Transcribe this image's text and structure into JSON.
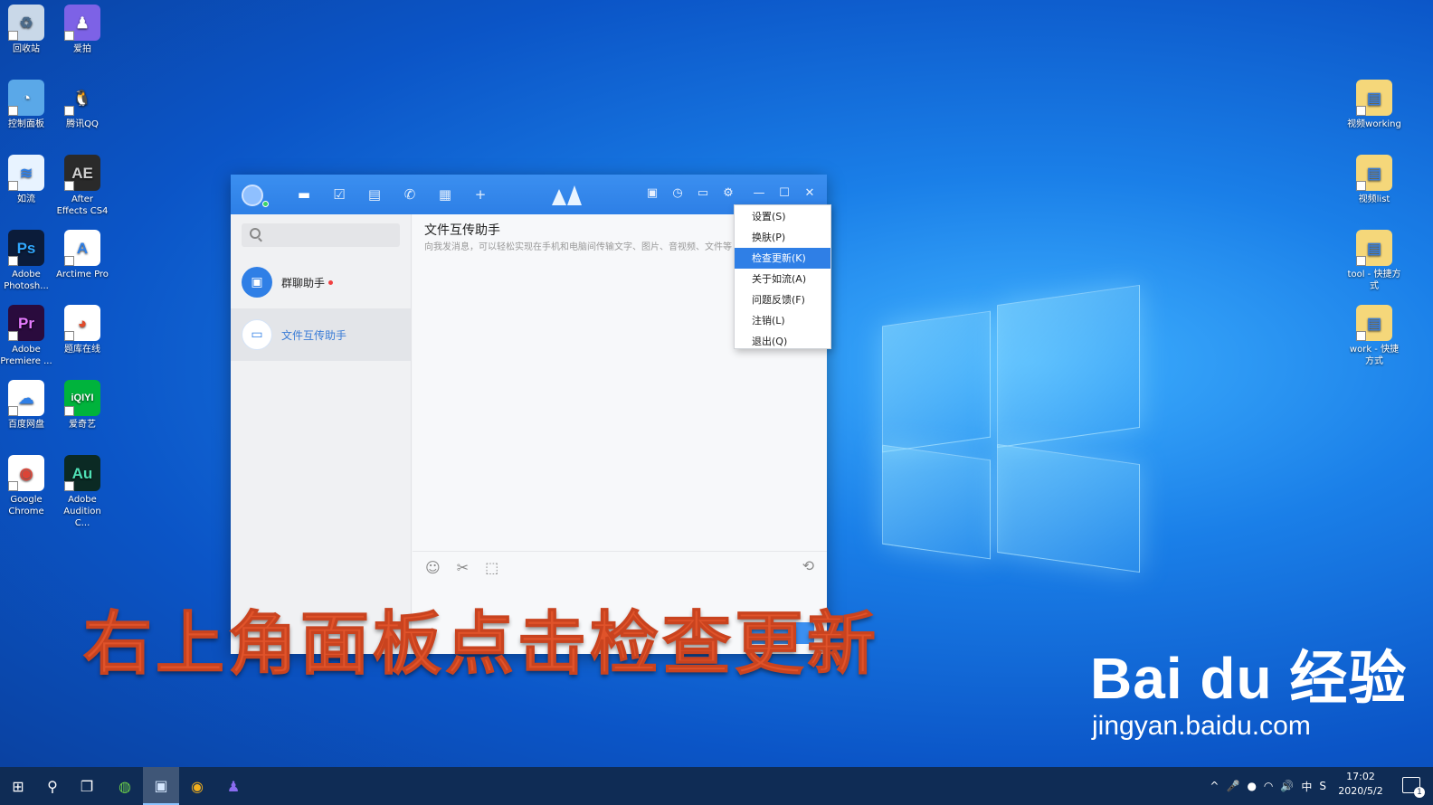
{
  "desktop_icons_left": [
    {
      "label": "回收站",
      "glyph": "♻",
      "bg": "#c9d8e8",
      "fg": "#4a6a8a"
    },
    {
      "label": "爱拍",
      "glyph": "♟",
      "bg": "#7d62e6",
      "fg": "#ffffff"
    },
    {
      "label": "控制面板",
      "glyph": "◔",
      "bg": "#5aa8e8",
      "fg": "#ffffff"
    },
    {
      "label": "腾讯QQ",
      "glyph": "🐧",
      "bg": "transparent",
      "fg": "#111111"
    },
    {
      "label": "如流",
      "glyph": "≋",
      "bg": "#e8f3ff",
      "fg": "#2f7fe6"
    },
    {
      "label": "After Effects CS4",
      "glyph": "AE",
      "bg": "#2a2a2a",
      "fg": "#cfcfcf"
    },
    {
      "label": "Adobe Photosh...",
      "glyph": "Ps",
      "bg": "#0b1c3a",
      "fg": "#31a8ff"
    },
    {
      "label": "Arctime Pro",
      "glyph": "A",
      "bg": "#ffffff",
      "fg": "#2f7fe6"
    },
    {
      "label": "Adobe Premiere ...",
      "glyph": "Pr",
      "bg": "#2a0b3d",
      "fg": "#e77cff"
    },
    {
      "label": "题库在线",
      "glyph": "◕",
      "bg": "#ffffff",
      "fg": "#e04a2a"
    },
    {
      "label": "百度网盘",
      "glyph": "☁",
      "bg": "#ffffff",
      "fg": "#2f7fe6"
    },
    {
      "label": "爱奇艺",
      "glyph": "iQIYI",
      "bg": "#00b33c",
      "fg": "#ffffff"
    },
    {
      "label": "Google Chrome",
      "glyph": "◉",
      "bg": "#ffffff",
      "fg": "#db4437"
    },
    {
      "label": "Adobe Audition C...",
      "glyph": "Au",
      "bg": "#0b2a24",
      "fg": "#4fe0b5"
    }
  ],
  "desktop_icons_right": [
    {
      "label": "视频working",
      "glyph": "▤",
      "bg": "#f5d77a",
      "fg": "#3a7cd6"
    },
    {
      "label": "视频list",
      "glyph": "▤",
      "bg": "#f5d77a",
      "fg": "#3a7cd6"
    },
    {
      "label": "tool - 快捷方式",
      "glyph": "▤",
      "bg": "#f5d77a",
      "fg": "#3a7cd6"
    },
    {
      "label": "work - 快捷方式",
      "glyph": "▤",
      "bg": "#f5d77a",
      "fg": "#3a7cd6"
    }
  ],
  "app": {
    "nav_icons": [
      "chat-icon",
      "calendar-icon",
      "contacts-icon",
      "phone-icon",
      "apps-icon",
      "plus-icon"
    ],
    "nav_glyphs": [
      "▬",
      "☑",
      "▤",
      "✆",
      "▦",
      "+"
    ],
    "window_glyphs": [
      "▣",
      "◷",
      "▭",
      "⚙",
      "—",
      "☐",
      "✕"
    ],
    "search": {
      "placeholder": ""
    },
    "chats": [
      {
        "name": "群聊助手",
        "glyph": "▣",
        "color": "#2f7fe6",
        "unread": true
      },
      {
        "name": "文件互传助手",
        "glyph": "▭",
        "color": "#ffffff",
        "unread": false
      }
    ],
    "main": {
      "title": "文件互传助手",
      "subtitle": "向我发消息，可以轻松实现在手机和电脑间传输文字、图片、音视频、文件等。"
    },
    "composer_tools": [
      "☺",
      "✂",
      "⬚"
    ],
    "history_glyph": "⟲"
  },
  "context_menu": {
    "items": [
      "设置(S)",
      "换肤(P)",
      "检查更新(K)",
      "关于如流(A)",
      "问题反馈(F)",
      "注销(L)",
      "退出(Q)"
    ],
    "highlighted_index": 2
  },
  "caption": "右上角面板点击检查更新",
  "watermark": {
    "line1": "Bai du 经验",
    "line2": "jingyan.baidu.com"
  },
  "taskbar": {
    "start_glyph": "⊞",
    "search_glyph": "⚲",
    "taskview_glyph": "❐",
    "apps": [
      "◍",
      "▣",
      "◉",
      "♟"
    ],
    "tray_glyphs": [
      "^",
      "🎤",
      "●",
      "◠",
      "🔊",
      "中",
      "S"
    ],
    "time": "17:02",
    "date": "2020/5/2",
    "notification_count": "1"
  }
}
